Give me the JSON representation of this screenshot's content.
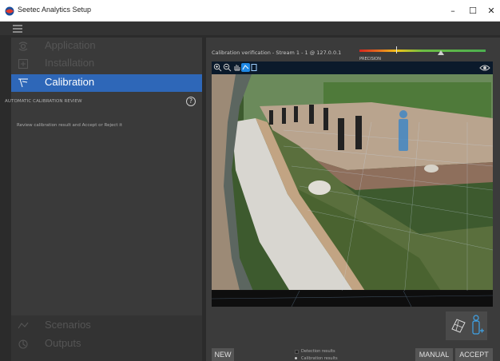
{
  "window": {
    "title": "Seetec Analytics Setup",
    "minimize": "–",
    "maximize": "☐",
    "close": "✕"
  },
  "sidebar": {
    "items": [
      {
        "label": "Application",
        "icon": "settings-icon",
        "state": "dim"
      },
      {
        "label": "Installation",
        "icon": "plus-box-icon",
        "state": "dim"
      },
      {
        "label": "Calibration",
        "icon": "calibration-icon",
        "state": "active"
      },
      {
        "label": "Scenarios",
        "icon": "scenarios-icon",
        "state": "dim"
      },
      {
        "label": "Outputs",
        "icon": "outputs-icon",
        "state": "dim"
      }
    ],
    "section_title": "AUTOMATIC CALIBRATION REVIEW",
    "help": "?",
    "instruction": "Review calibration result and Accept or Reject it"
  },
  "main": {
    "verification_title": "Calibration verification - Stream 1 - 1 @ 127.0.0.1",
    "precision_label": "PRECISION",
    "toolbar_icons": [
      "zoom-in-icon",
      "zoom-out-icon",
      "pan-icon",
      "select-icon",
      "reset-icon"
    ],
    "buttons": {
      "new": "NEW",
      "manual": "MANUAL",
      "accept": "ACCEPT"
    },
    "legend": {
      "detection": "Detection results",
      "calibration": "Calibration results"
    }
  },
  "colors": {
    "accent": "#2e67b8",
    "background": "#2b2b2b",
    "panel": "#3a3a3a"
  }
}
